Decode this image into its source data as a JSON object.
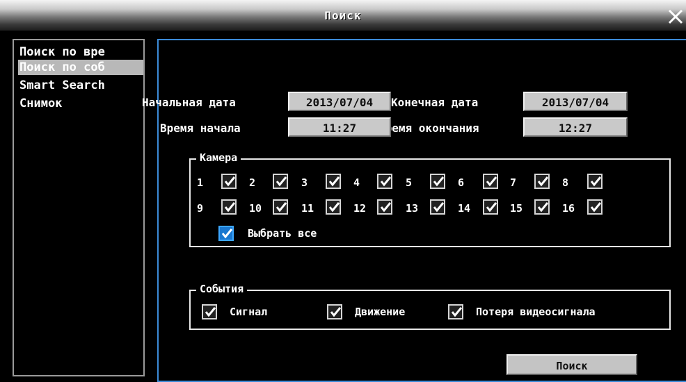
{
  "window": {
    "title": "Поиск",
    "close_icon": "close-icon"
  },
  "sidebar": {
    "items": [
      {
        "label": "Поиск по вре",
        "selected": false
      },
      {
        "label": "Поиск по соб",
        "selected": true
      },
      {
        "label": "Smart Search",
        "selected": false
      },
      {
        "label": "Снимок",
        "selected": false
      }
    ]
  },
  "form": {
    "start_date_label": "Начальная дата",
    "start_date_value": "2013/07/04",
    "end_date_label": "Конечная дата",
    "end_date_value": "2013/07/04",
    "start_time_label": "Время начала",
    "start_time_value": "11:27",
    "end_time_label": "Время окончания",
    "end_time_value": "12:27"
  },
  "camera_group": {
    "legend": "Камера",
    "cameras": [
      "1",
      "2",
      "3",
      "4",
      "5",
      "6",
      "7",
      "8",
      "9",
      "10",
      "11",
      "12",
      "13",
      "14",
      "15",
      "16"
    ],
    "checked": true,
    "select_all_label": "Выбрать все",
    "select_all_checked": true
  },
  "events_group": {
    "legend": "События",
    "items": [
      {
        "label": "Сигнал",
        "checked": true
      },
      {
        "label": "Движение",
        "checked": true
      },
      {
        "label": "Потеря видеосигнала",
        "checked": true
      }
    ]
  },
  "search_button_label": "Поиск",
  "colors": {
    "accent_border": "#3c8bd8",
    "select_all_box": "#1a78d0",
    "selection_bg": "#b8b8b8"
  }
}
